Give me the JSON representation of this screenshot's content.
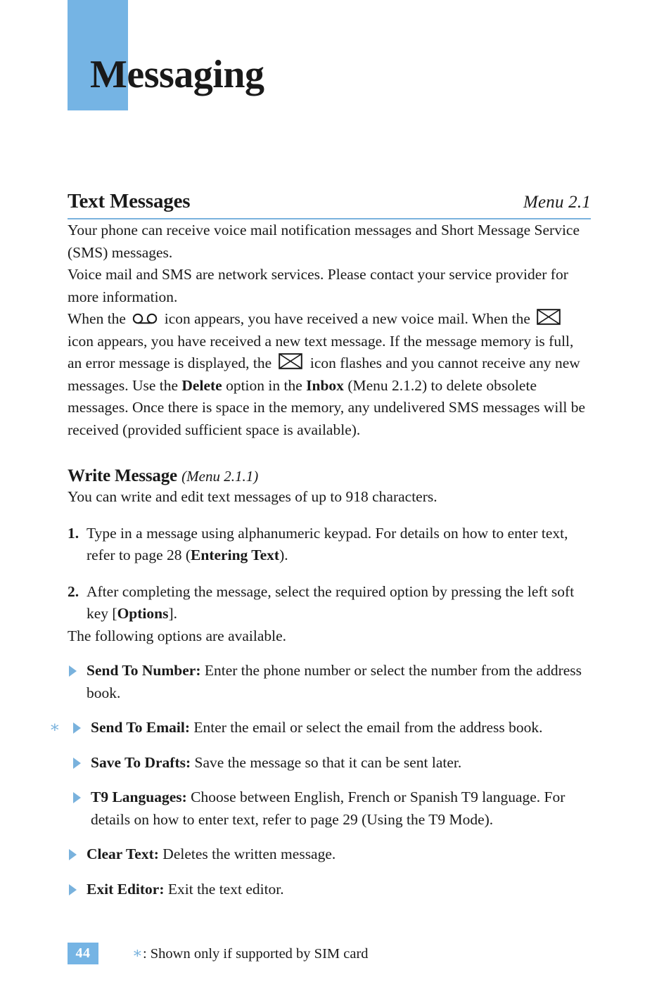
{
  "chapter": {
    "title": "Messaging",
    "accent_color": "#75b4e4"
  },
  "section": {
    "title": "Text Messages",
    "menu_ref": "Menu 2.1",
    "rule_color": "#79b2dd"
  },
  "paragraphs": {
    "intro": "Your phone can receive voice mail notification messages and Short Message Service (SMS) messages.",
    "second": "Voice mail and SMS are network services. Please contact your service provider for more information.",
    "icons_part1": "When the",
    "icons_part2": "icon appears, you have received a new voice mail. When the",
    "icons_part3": "icon appears, you have received a new text message. If the message memory is full, an error message is displayed, the",
    "icons_part4": "icon flashes and you cannot receive any new messages. Use the",
    "icons_bold1": "Delete",
    "icons_part5": "option in the",
    "icons_bold2": "Inbox",
    "icons_part6": "(Menu 2.1.2) to delete obsolete messages. Once there is space in the memory, any undelivered SMS messages will be received (provided sufficient space is available)."
  },
  "subsection": {
    "title": "Write Message",
    "menu_ref": "(Menu 2.1.1)",
    "intro": "You can write and edit text messages of up to 918 characters."
  },
  "steps": [
    {
      "num": "1.",
      "text_a": "Type in a message using alphanumeric keypad. For details on how to enter text, refer to page 28 (",
      "bold": "Entering Text",
      "text_b": ")."
    },
    {
      "num": "2.",
      "text_a": "After completing the message, select the required option by pressing the left soft key [",
      "bold": "Options",
      "text_b": "]."
    }
  ],
  "options_intro": "The following options are available.",
  "options": [
    {
      "name": "Send To Number:",
      "desc": "Enter the phone number or select the number from the address book.",
      "sim_only": false,
      "indented": false
    },
    {
      "name": "Send To Email:",
      "desc": "Enter the email or select the email from the address book.",
      "sim_only": true,
      "indented": true
    },
    {
      "name": "Save To Drafts:",
      "desc": "Save the message so that it can be sent later.",
      "sim_only": false,
      "indented": true
    },
    {
      "name": "T9 Languages:",
      "desc": "Choose between English, French or Spanish T9 language. For details on how to enter text, refer to page 29 (Using the T9 Mode).",
      "sim_only": false,
      "indented": true
    },
    {
      "name": "Clear Text:",
      "desc": "Deletes the written message.",
      "sim_only": false,
      "indented": false
    },
    {
      "name": "Exit Editor:",
      "desc": "Exit the text editor.",
      "sim_only": false,
      "indented": false
    }
  ],
  "footer": {
    "page_number": "44",
    "footnote_star": "∗",
    "footnote_text": ": Shown only if supported by SIM card"
  },
  "icons": {
    "voicemail": "voicemail-icon",
    "envelope": "envelope-icon"
  }
}
